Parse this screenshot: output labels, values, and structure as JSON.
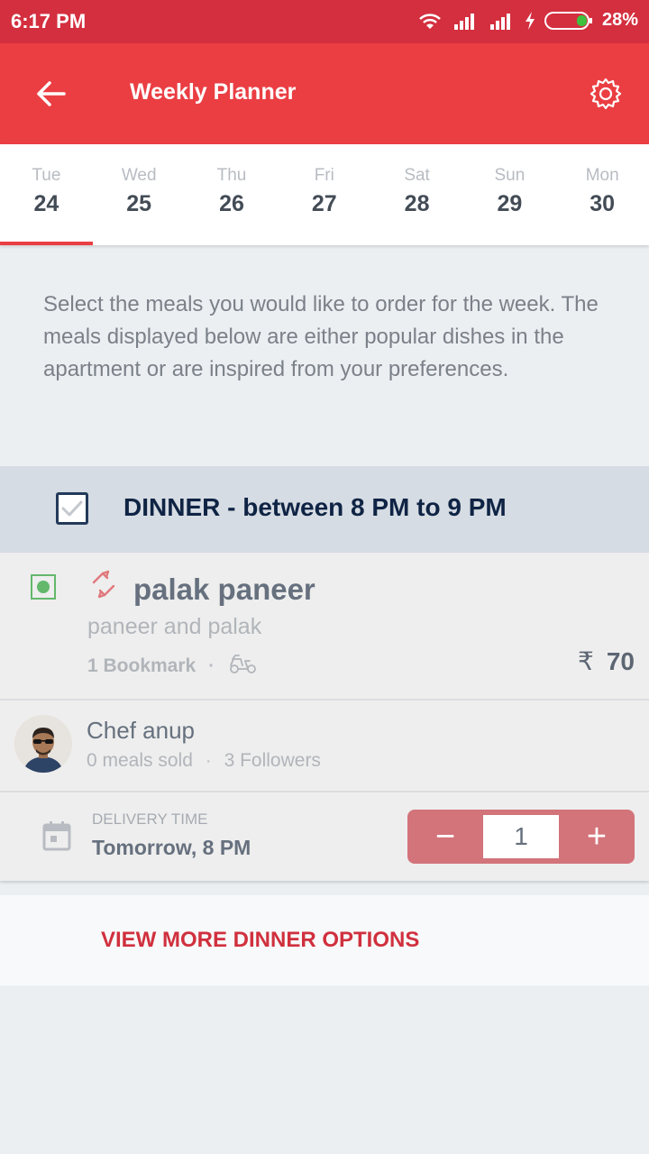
{
  "status_bar": {
    "time": "6:17 PM",
    "battery": "28%"
  },
  "app_bar": {
    "title": "Weekly Planner"
  },
  "days": [
    {
      "name": "Tue",
      "num": "24"
    },
    {
      "name": "Wed",
      "num": "25"
    },
    {
      "name": "Thu",
      "num": "26"
    },
    {
      "name": "Fri",
      "num": "27"
    },
    {
      "name": "Sat",
      "num": "28"
    },
    {
      "name": "Sun",
      "num": "29"
    },
    {
      "name": "Mon",
      "num": "30"
    }
  ],
  "intro": "Select the meals you would like to order for the week. The meals displayed below are either popular dishes in the apartment or are inspired from your preferences.",
  "meal_section": {
    "title": "DINNER - between 8 PM to 9 PM"
  },
  "dish": {
    "name": "palak paneer",
    "description": "paneer and palak",
    "bookmarks": "1 Bookmark",
    "currency": "₹",
    "price": "70"
  },
  "chef": {
    "name": "Chef anup",
    "meals_sold": "0 meals sold",
    "followers": "3 Followers"
  },
  "delivery": {
    "label": "DELIVERY TIME",
    "value": "Tomorrow, 8 PM"
  },
  "stepper": {
    "minus": "−",
    "quantity": "1",
    "plus": "+"
  },
  "more_options": {
    "label": "VIEW MORE DINNER OPTIONS"
  },
  "colors": {
    "primary": "#ea3e43",
    "status_bar": "#d42f3f",
    "veg": "#63b86c",
    "stepper": "#d3737a"
  }
}
